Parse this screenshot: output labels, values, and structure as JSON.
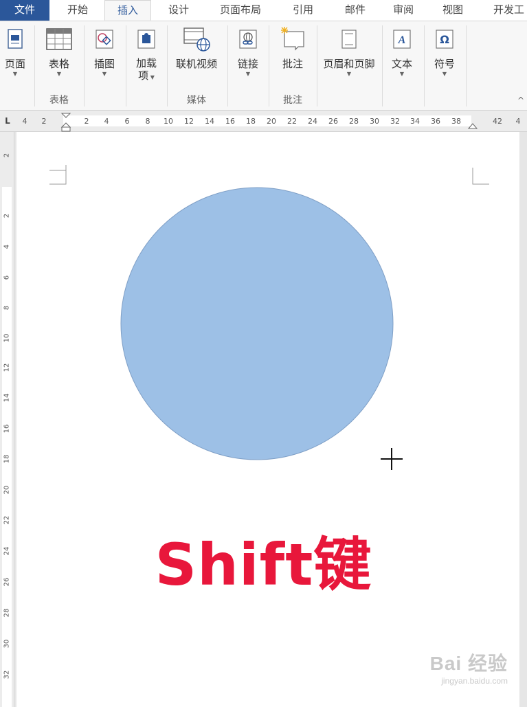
{
  "tabs": [
    {
      "label": "文件",
      "kind": "file"
    },
    {
      "label": "开始"
    },
    {
      "label": "插入",
      "kind": "active"
    },
    {
      "label": "设计"
    },
    {
      "label": "页面布局"
    },
    {
      "label": "引用"
    },
    {
      "label": "邮件"
    },
    {
      "label": "审阅"
    },
    {
      "label": "视图"
    },
    {
      "label": "开发工"
    }
  ],
  "ribbon": {
    "buttons": {
      "page": {
        "label": "页面",
        "icon": "page-icon"
      },
      "table": {
        "label": "表格",
        "icon": "table-icon"
      },
      "illustrations": {
        "label": "插图",
        "icon": "shapes-icon"
      },
      "addins": {
        "label": "加载",
        "label2": "项",
        "icon": "addins-icon"
      },
      "online_video": {
        "label": "联机视频",
        "icon": "online-video-icon"
      },
      "link": {
        "label": "链接",
        "icon": "link-icon"
      },
      "comment": {
        "label": "批注",
        "icon": "comment-icon"
      },
      "header_footer": {
        "label": "页眉和页脚",
        "icon": "header-footer-icon"
      },
      "text": {
        "label": "文本",
        "icon": "text-icon"
      },
      "symbols": {
        "label": "符号",
        "icon": "omega-icon"
      }
    },
    "groups": {
      "table": "表格",
      "media": "媒体",
      "comments": "批注"
    },
    "collapse_glyph": "^"
  },
  "hruler": {
    "left_ticks": [
      "4",
      "2"
    ],
    "ticks": [
      "2",
      "4",
      "6",
      "8",
      "10",
      "12",
      "14",
      "16",
      "18",
      "20",
      "22",
      "24",
      "26",
      "28",
      "30",
      "32",
      "34",
      "36",
      "38",
      "42",
      "4"
    ],
    "corner": "L"
  },
  "vruler": {
    "ticks": [
      "2",
      "2",
      "4",
      "6",
      "8",
      "10",
      "12",
      "14",
      "16",
      "18",
      "20",
      "22",
      "24",
      "26",
      "28",
      "30",
      "32"
    ]
  },
  "document": {
    "circle_fill": "#9dc0e6",
    "circle_stroke": "#7f9fc6",
    "text": "Shift键",
    "text_color": "#e8173b"
  },
  "watermark": {
    "main": "Bai 经验",
    "sub": "jingyan.baidu.com"
  },
  "colors": {
    "accent": "#2b579a"
  }
}
